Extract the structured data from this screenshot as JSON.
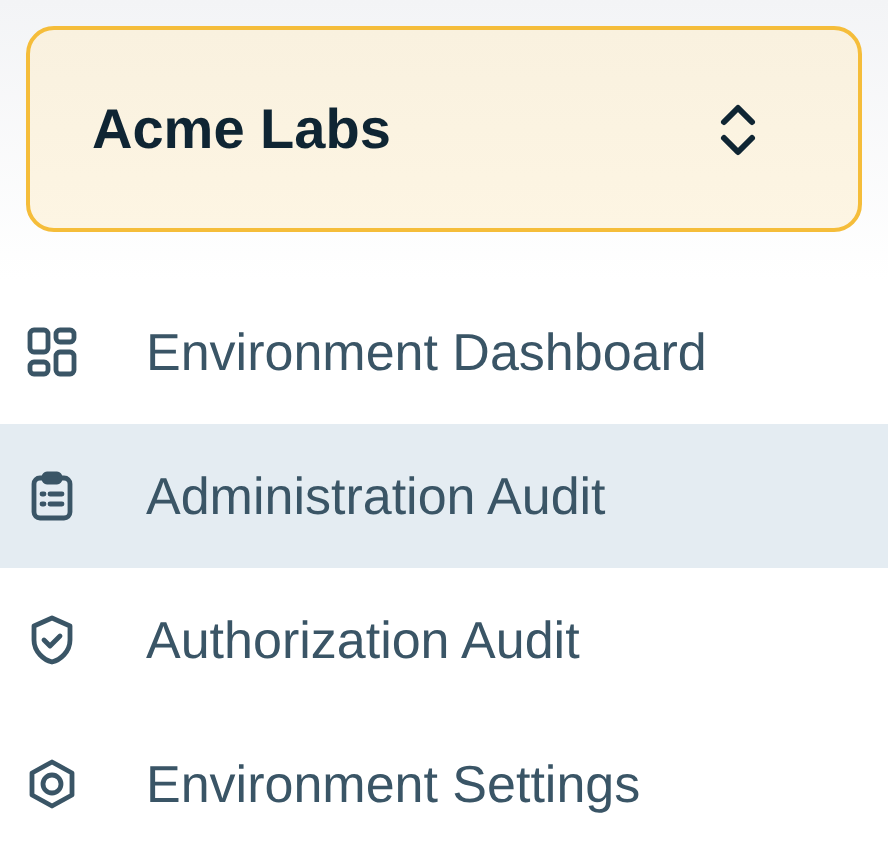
{
  "org_switcher": {
    "name": "Acme Labs"
  },
  "nav_items": [
    {
      "label": "Environment Dashboard",
      "kind": "dashboard",
      "selected": false
    },
    {
      "label": "Administration Audit",
      "kind": "clipboard",
      "selected": true
    },
    {
      "label": "Authorization Audit",
      "kind": "shield",
      "selected": false
    },
    {
      "label": "Environment Settings",
      "kind": "settings",
      "selected": false
    }
  ]
}
